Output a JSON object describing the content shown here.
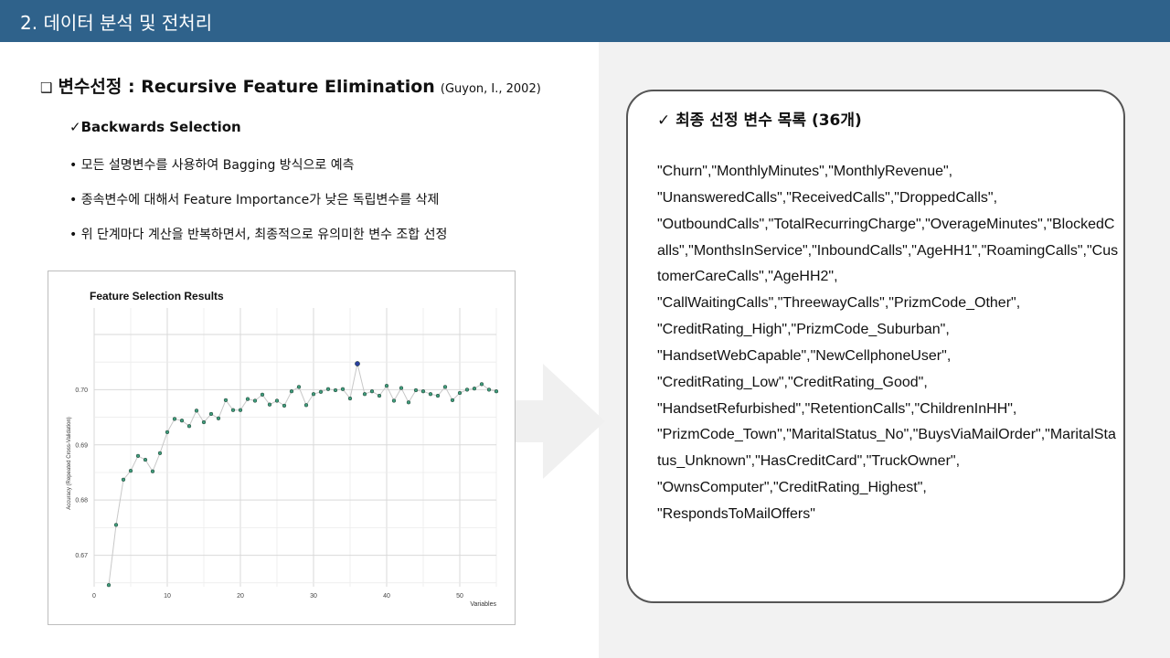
{
  "header": {
    "title": "2. 데이터 분석 및 전처리"
  },
  "left": {
    "section_checkbox": "❑",
    "section_title": "변수선정",
    "section_colon": " : ",
    "section_method": "Recursive Feature Elimination",
    "section_cite": "(Guyon, I., 2002)",
    "sub_title": "✓Backwards Selection",
    "bullets": [
      "• 모든 설명변수를 사용하여 Bagging 방식으로 예측",
      "• 종속변수에 대해서 Feature Importance가 낮은 독립변수를 삭제",
      "• 위 단계마다 계산을 반복하면서, 최종적으로 유의미한 변수 조합 선정"
    ]
  },
  "chart_data": {
    "type": "line",
    "title": "Feature Selection Results",
    "xlabel": "Variables",
    "ylabel": "Accuracy (Repeated Cross-Validation)",
    "xlim": [
      0,
      55
    ],
    "ylim": [
      0.6643,
      0.7148
    ],
    "x_ticks": [
      0,
      10,
      20,
      30,
      40,
      50
    ],
    "y_ticks": [
      0.67,
      0.68,
      0.69,
      0.7
    ],
    "grid": true,
    "point_color": "#3f9c7c",
    "line_color": "#c8c8c8",
    "highlight_color": "#2a3f9e",
    "best_x": 36,
    "x": [
      2,
      3,
      4,
      5,
      6,
      7,
      8,
      9,
      10,
      11,
      12,
      13,
      14,
      15,
      16,
      17,
      18,
      19,
      20,
      21,
      22,
      23,
      24,
      25,
      26,
      27,
      28,
      29,
      30,
      31,
      32,
      33,
      34,
      35,
      36,
      37,
      38,
      39,
      40,
      41,
      42,
      43,
      44,
      45,
      46,
      47,
      48,
      49,
      50,
      51,
      52,
      53,
      54,
      55
    ],
    "values": [
      0.6646,
      0.6755,
      0.6837,
      0.6853,
      0.688,
      0.6873,
      0.6852,
      0.6885,
      0.6923,
      0.6947,
      0.6944,
      0.6934,
      0.6962,
      0.6941,
      0.6956,
      0.6948,
      0.6981,
      0.6963,
      0.6963,
      0.6983,
      0.698,
      0.6991,
      0.6973,
      0.698,
      0.6971,
      0.6997,
      0.7005,
      0.6972,
      0.6992,
      0.6996,
      0.7001,
      0.6999,
      0.7001,
      0.6984,
      0.7047,
      0.6992,
      0.6997,
      0.6989,
      0.7007,
      0.698,
      0.7003,
      0.6977,
      0.6999,
      0.6997,
      0.6992,
      0.6989,
      0.7005,
      0.6981,
      0.6994,
      0.7,
      0.7002,
      0.701,
      0.7,
      0.6997,
      0.7011
    ]
  },
  "right": {
    "card_title": "✓ 최종 선정 변수 목록 (36개)",
    "variable_lines": [
      "\"Churn\",\"MonthlyMinutes\",\"MonthlyRevenue\",",
      "\"UnansweredCalls\",\"ReceivedCalls\",\"DroppedCalls\",",
      "\"OutboundCalls\",\"TotalRecurringCharge\",\"OverageMinutes\",\"BlockedC",
      "alls\",\"MonthsInService\",\"InboundCalls\",\"AgeHH1\",\"RoamingCalls\",\"Cus",
      "tomerCareCalls\",\"AgeHH2\",",
      "\"CallWaitingCalls\",\"ThreewayCalls\",\"PrizmCode_Other\",",
      "\"CreditRating_High\",\"PrizmCode_Suburban\",",
      "\"HandsetWebCapable\",\"NewCellphoneUser\",",
      "\"CreditRating_Low\",\"CreditRating_Good\",",
      "\"HandsetRefurbished\",\"RetentionCalls\",\"ChildrenInHH\",",
      "\"PrizmCode_Town\",\"MaritalStatus_No\",\"BuysViaMailOrder\",\"MaritalSta",
      "tus_Unknown\",\"HasCreditCard\",\"TruckOwner\",",
      "\"OwnsComputer\",\"CreditRating_Highest\",",
      "\"RespondsToMailOffers\""
    ]
  }
}
